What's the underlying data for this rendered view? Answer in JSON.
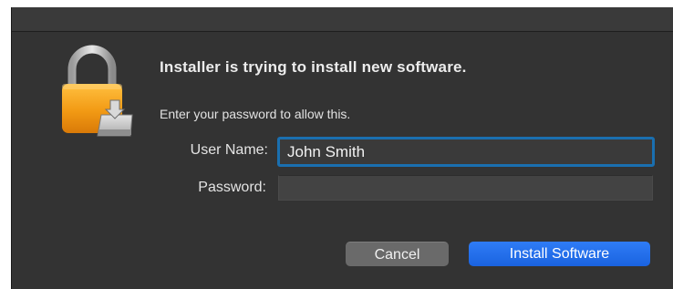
{
  "dialog": {
    "heading": "Installer is trying to install new software.",
    "subtext": "Enter your password to allow this.",
    "icon": "lock-icon"
  },
  "form": {
    "username_label": "User Name:",
    "username_value": "John Smith",
    "password_label": "Password:",
    "password_value": ""
  },
  "buttons": {
    "cancel_label": "Cancel",
    "install_label": "Install Software"
  },
  "colors": {
    "dialog_bg": "#333333",
    "accent_blue": "#1a63e0",
    "focus_ring": "#1a6fb0",
    "lock_orange": "#f0a020"
  }
}
